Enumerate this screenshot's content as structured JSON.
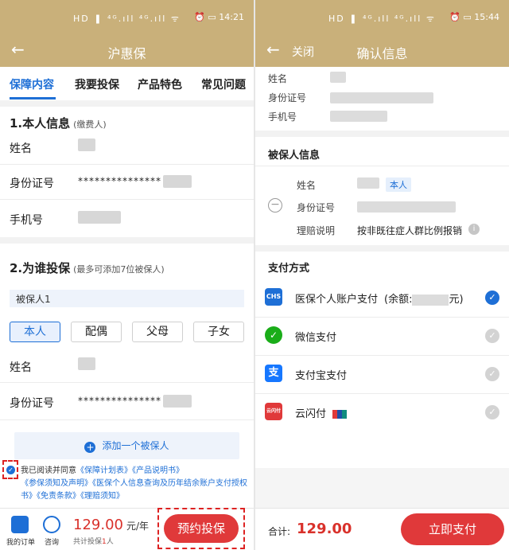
{
  "left": {
    "status": {
      "signal": "HD ❚ ⁴ᴳ.ıll ⁴ᴳ.ıll ᯤ",
      "right": "⏰ ▭ 14:21"
    },
    "nav": {
      "back_icon": "←",
      "title": "沪惠保"
    },
    "tabs": [
      "保障内容",
      "我要投保",
      "产品特色",
      "常见问题"
    ],
    "section1": {
      "title": "1.本人信息",
      "sub": "(缴费人)"
    },
    "fields1": [
      {
        "label": "姓名",
        "value": ""
      },
      {
        "label": "身份证号",
        "value": "***************"
      },
      {
        "label": "手机号",
        "value": ""
      }
    ],
    "section2": {
      "title": "2.为谁投保",
      "sub": "(最多可添加7位被保人)"
    },
    "insured_bar": "被保人1",
    "relations": [
      "本人",
      "配偶",
      "父母",
      "子女"
    ],
    "fields2": [
      {
        "label": "姓名",
        "value": ""
      },
      {
        "label": "身份证号",
        "value": "***************"
      }
    ],
    "add_insured": "添加一个被保人",
    "agree": {
      "prefix": "我已阅读并同意",
      "links": [
        "《保障计划表》",
        "《产品说明书》",
        "《参保须知及声明》",
        "《医保个人信息查询及历年结余账户支付授权书》",
        "《免责条款》",
        "《理赔须知》"
      ]
    },
    "bottom": {
      "orders": "我的订单",
      "consult": "咨询",
      "price": "129.00",
      "price_unit": "元/年",
      "count_prefix": "共计投保",
      "count": "1",
      "count_suffix": "人",
      "book": "预约投保"
    }
  },
  "right": {
    "status": {
      "signal": "HD ❚ ⁴ᴳ.ıll ⁴ᴳ.ıll ᯤ",
      "right": "⏰ ▭ 15:44"
    },
    "nav": {
      "back_icon": "←",
      "close": "关闭",
      "title": "确认信息"
    },
    "top_fields": [
      "姓名",
      "身份证号",
      "手机号"
    ],
    "insured": {
      "title": "被保人信息",
      "name_label": "姓名",
      "self_tag": "本人",
      "id_label": "身份证号",
      "claim_label": "理赔说明",
      "claim_value": "按非既往症人群比例报销",
      "minus_icon": "−",
      "info_icon": "i"
    },
    "payment": {
      "title": "支付方式",
      "methods": [
        {
          "icon": "CHS",
          "label": "医保个人账户支付",
          "balance_prefix": "(余额:",
          "balance_suffix": "元)",
          "color": "#1e6fd6",
          "selected": true
        },
        {
          "icon": "✓",
          "label": "微信支付",
          "color": "#1aad19",
          "selected": false
        },
        {
          "icon": "支",
          "label": "支付宝支付",
          "color": "#1677ff",
          "selected": false
        },
        {
          "icon": "云闪付",
          "label": "云闪付",
          "color": "#e0393a",
          "selected": false
        }
      ]
    },
    "bottom": {
      "total_label": "合计:",
      "total": "129.00",
      "pay": "立即支付"
    }
  }
}
